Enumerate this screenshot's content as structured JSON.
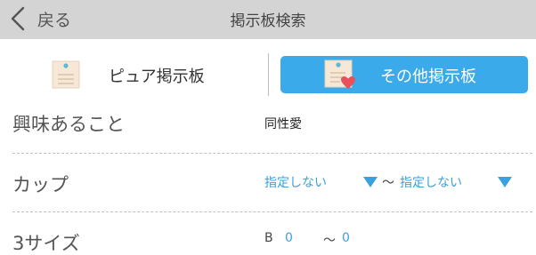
{
  "header": {
    "back_label": "戻る",
    "title": "掲示板検索"
  },
  "tabs": [
    {
      "label": "ピュア掲示板",
      "icon": "memo-icon",
      "active": false
    },
    {
      "label": "その他掲示板",
      "icon": "memo-heart-icon",
      "active": true
    }
  ],
  "form": {
    "interest": {
      "label": "興味あること",
      "value": "同性愛"
    },
    "cup": {
      "label": "カップ",
      "from": "指定しない",
      "separator": "〜",
      "to": "指定しない"
    },
    "three_size": {
      "label": "3サイズ",
      "prefix": "B",
      "from": "0",
      "separator": "〜",
      "to": "0"
    }
  },
  "colors": {
    "header_bg": "#d4d4d4",
    "accent": "#3aaaea",
    "link_blue": "#3aa0e0",
    "heart": "#e8505b",
    "memo_bg": "#f7e7d6"
  }
}
